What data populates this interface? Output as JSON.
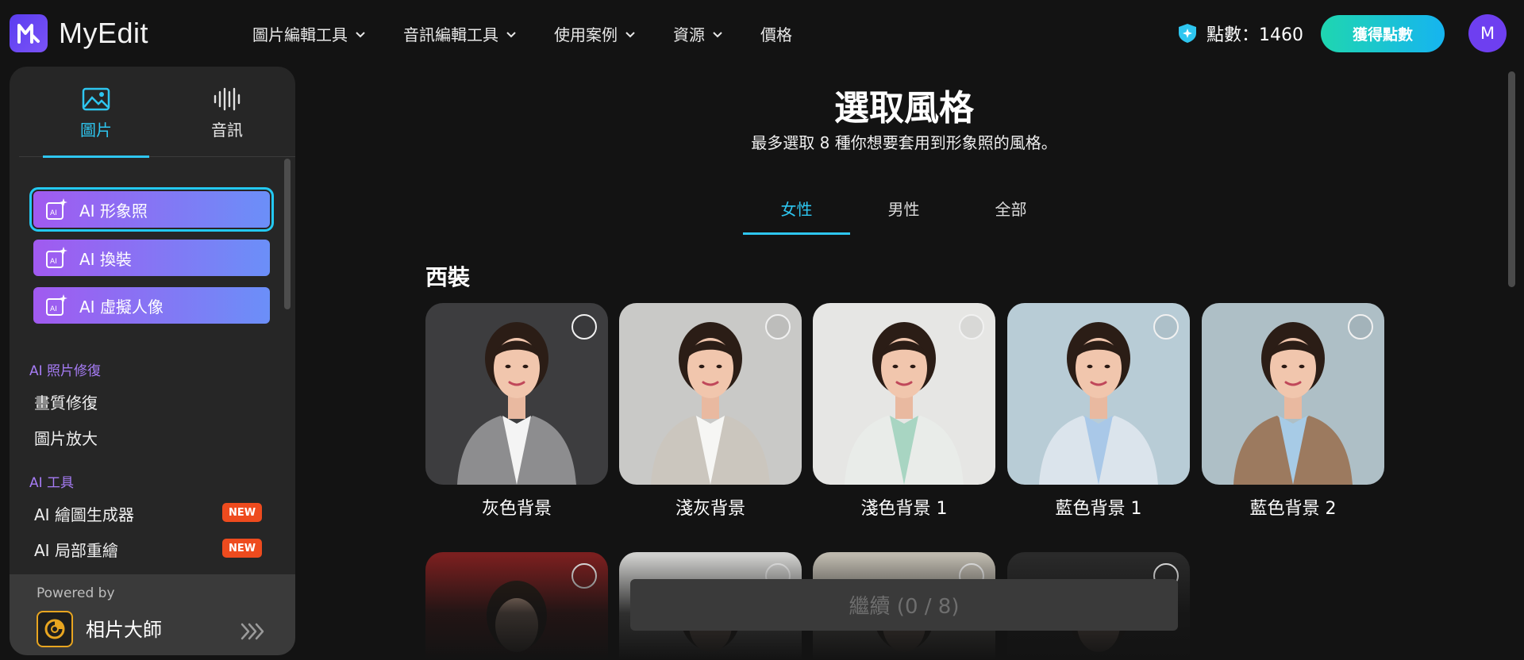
{
  "app": {
    "name": "MyEdit",
    "logo_letter": "M"
  },
  "nav": [
    {
      "label": "圖片編輯工具",
      "has_dropdown": true
    },
    {
      "label": "音訊編輯工具",
      "has_dropdown": true
    },
    {
      "label": "使用案例",
      "has_dropdown": true
    },
    {
      "label": "資源",
      "has_dropdown": true
    },
    {
      "label": "價格",
      "has_dropdown": false
    }
  ],
  "header": {
    "points_label": "點數：1460",
    "get_points_label": "獲得點數",
    "avatar_initial": "M"
  },
  "sidebar": {
    "tabs": [
      {
        "label": "圖片",
        "icon": "image-icon",
        "active": true
      },
      {
        "label": "音訊",
        "icon": "audio-wave-icon",
        "active": false
      }
    ],
    "ai_buttons": [
      {
        "label": "AI 形象照",
        "selected": true
      },
      {
        "label": "AI 換裝",
        "selected": false
      },
      {
        "label": "AI 虛擬人像",
        "selected": false
      }
    ],
    "sections": [
      {
        "title": "AI 照片修復",
        "items": [
          {
            "label": "畫質修復"
          },
          {
            "label": "圖片放大"
          }
        ]
      },
      {
        "title": "AI 工具",
        "items": [
          {
            "label": "AI 繪圖生成器",
            "badge": "NEW"
          },
          {
            "label": "AI 局部重繪",
            "badge": "NEW"
          }
        ]
      }
    ],
    "powered_by": {
      "label": "Powered by",
      "product": "相片大師"
    }
  },
  "main": {
    "title": "選取風格",
    "subtitle": "最多選取 8 種你想要套用到形象照的風格。",
    "gender_tabs": [
      {
        "label": "女性",
        "active": true
      },
      {
        "label": "男性",
        "active": false
      },
      {
        "label": "全部",
        "active": false
      }
    ],
    "category": "西裝",
    "styles": [
      {
        "label": "灰色背景",
        "bg": "#3d3d3f",
        "suit": "#8d8d8f",
        "shirt": "#f4f4f4"
      },
      {
        "label": "淺灰背景",
        "bg": "#c9c9c7",
        "suit": "#cbc6be",
        "shirt": "#f6f6f4"
      },
      {
        "label": "淺色背景 1",
        "bg": "#e6e6e4",
        "suit": "#e9ece9",
        "shirt": "#a8d5c2"
      },
      {
        "label": "藍色背景 1",
        "bg": "#b8ccd6",
        "suit": "#dbe4ec",
        "shirt": "#a9c8e8"
      },
      {
        "label": "藍色背景 2",
        "bg": "#aebfc6",
        "suit": "#9c7a5f",
        "shirt": "#a7cbe6"
      }
    ],
    "styles_row2": [
      {
        "bg": "#7a1f1f"
      },
      {
        "bg": "#cfcfcd"
      },
      {
        "bg": "#bdb8ad"
      },
      {
        "bg": "#2a2a2a"
      }
    ],
    "continue_label": "繼續 (0 / 8)"
  },
  "colors": {
    "accent": "#2ec6f0",
    "ai_gradient_start": "#a15af0",
    "ai_gradient_end": "#6b8ff8",
    "new_badge": "#ee4b1e",
    "section_title": "#a67cf5"
  }
}
